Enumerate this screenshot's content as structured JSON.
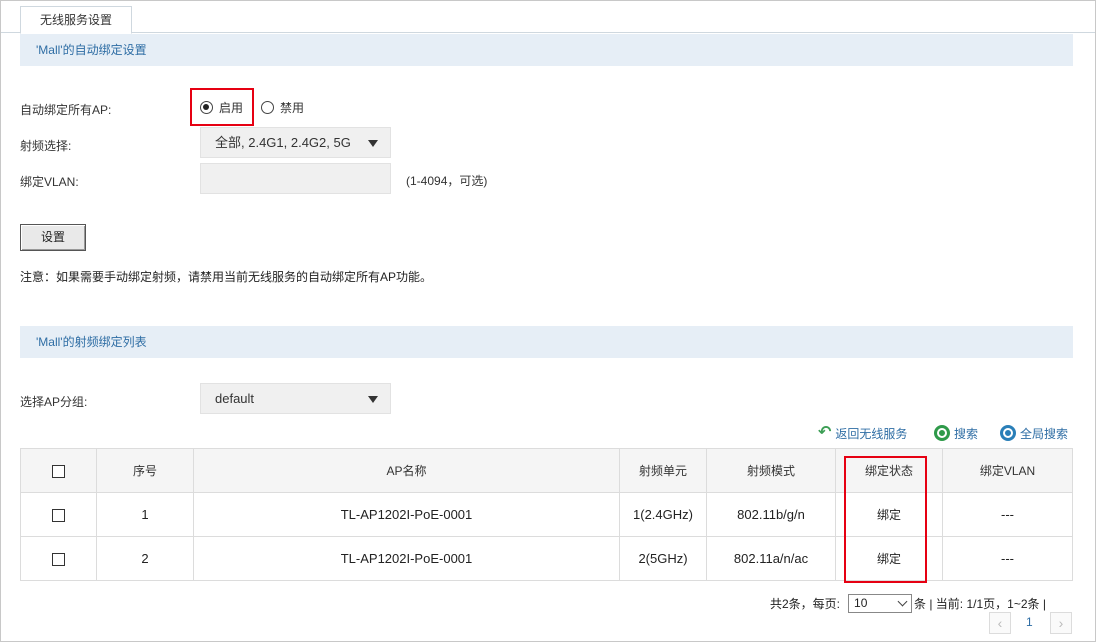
{
  "tab": {
    "label": "无线服务设置"
  },
  "auto_bind_section": {
    "title": "'Mall'的自动绑定设置",
    "auto_bind_label": "自动绑定所有AP:",
    "enable_label": "启用",
    "disable_label": "禁用",
    "selected": "enable",
    "radio_select_label": "射频选择:",
    "radio_select_value": "全部, 2.4G1, 2.4G2, 5G",
    "vlan_label": "绑定VLAN:",
    "vlan_value": "",
    "vlan_hint": "(1-4094，可选)",
    "set_button": "设置",
    "note": "注意：如果需要手动绑定射频，请禁用当前无线服务的自动绑定所有AP功能。"
  },
  "binding_list_section": {
    "title": "'Mall'的射频绑定列表",
    "ap_group_label": "选择AP分组:",
    "ap_group_value": "default",
    "actions": {
      "back": "返回无线服务",
      "search": "搜索",
      "global_search": "全局搜索"
    },
    "columns": [
      "序号",
      "AP名称",
      "射频单元",
      "射频模式",
      "绑定状态",
      "绑定VLAN"
    ],
    "rows": [
      {
        "index": "1",
        "ap_name": "TL-AP1202I-PoE-0001",
        "radio_unit": "1(2.4GHz)",
        "radio_mode": "802.11b/g/n",
        "status": "绑定",
        "vlan": "---"
      },
      {
        "index": "2",
        "ap_name": "TL-AP1202I-PoE-0001",
        "radio_unit": "2(5GHz)",
        "radio_mode": "802.11a/n/ac",
        "status": "绑定",
        "vlan": "---"
      }
    ]
  },
  "pagination": {
    "total_prefix": "共2条，每页:",
    "per_page": "10",
    "suffix": "条 | 当前: 1/1页，1~2条 |",
    "current_page": "1",
    "prev_icon": "‹",
    "next_icon": "›"
  },
  "colors": {
    "accent": "#2e6da4",
    "section_bg": "#e6eef6",
    "highlight": "#e60012",
    "icon_green": "#2f9a4a"
  }
}
